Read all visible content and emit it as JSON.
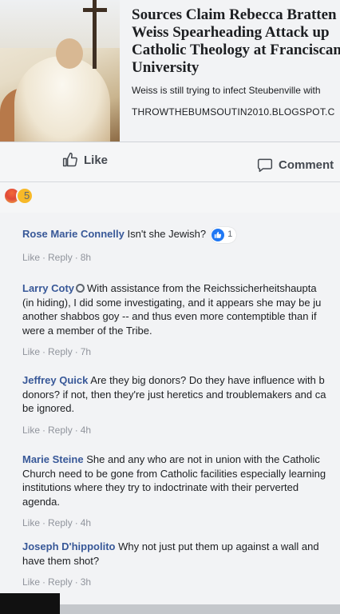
{
  "link_card": {
    "title": "Sources Claim Rebecca Bratten\nWeiss Spearheading Attack up\nCatholic Theology at Franciscan\nUniversity",
    "description": "Weiss is still trying to infect Steubenville with",
    "domain": "THROWTHEBUMSOUTIN2010.BLOGSPOT.C"
  },
  "actions": {
    "like_label": "Like",
    "comment_label": "Comment"
  },
  "reactions": {
    "count": "5",
    "icons": [
      "angry-face-icon",
      "sad-face-icon"
    ]
  },
  "comments": [
    {
      "author": "Rose Marie Connelly",
      "text": "Isn't she Jewish?",
      "like_label": "Like",
      "reply_label": "Reply",
      "time": "8h",
      "like_count": "1"
    },
    {
      "author": "Larry Coty",
      "text": "With assistance from the Reichssicherheitshaupta\n(in hiding), I did some investigating, and it appears she may be ju\nanother shabbos goy -- and thus even more contemptible than if\nwere a member of the Tribe.",
      "like_label": "Like",
      "reply_label": "Reply",
      "time": "7h"
    },
    {
      "author": "Jeffrey Quick",
      "text": "Are they big donors? Do they have influence with b\ndonors? if not, then they're just heretics and troublemakers and ca\nbe ignored.",
      "like_label": "Like",
      "reply_label": "Reply",
      "time": "4h"
    },
    {
      "author": "Marie Steine",
      "text": "She and any who are not in union with the Catholic\nChurch need to be gone from Catholic facilities especially learning\ninstitutions where they try to indoctrinate with their perverted\nagenda.",
      "like_label": "Like",
      "reply_label": "Reply",
      "time": "4h"
    },
    {
      "author": "Joseph D'hippolito",
      "text": "Why not just put them up against a wall and\nhave them shot?",
      "like_label": "Like",
      "reply_label": "Reply",
      "time": "3h"
    }
  ],
  "colors": {
    "author_link": "#385898",
    "meta_gray": "#90949c",
    "like_blue": "#2078f4"
  }
}
